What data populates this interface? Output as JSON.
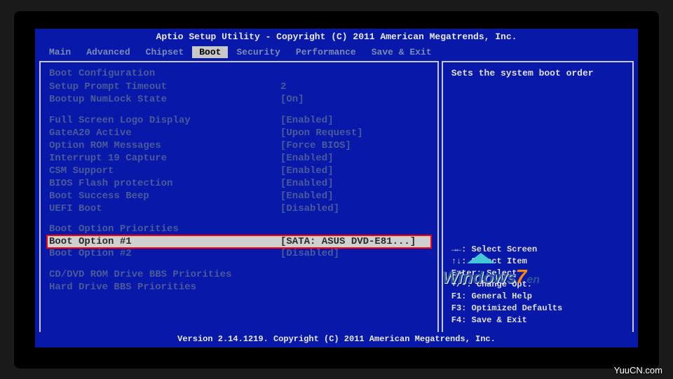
{
  "header": {
    "title": "Aptio Setup Utility - Copyright (C) 2011 American Megatrends, Inc."
  },
  "menu": {
    "items": [
      "Main",
      "Advanced",
      "Chipset",
      "Boot",
      "Security",
      "Performance",
      "Save & Exit"
    ],
    "active_index": 3
  },
  "boot": {
    "section_config": "Boot Configuration",
    "rows_config": [
      {
        "label": "Setup Prompt Timeout",
        "value": "2"
      },
      {
        "label": "Bootup NumLock State",
        "value": "[On]"
      }
    ],
    "rows_display": [
      {
        "label": "Full Screen Logo Display",
        "value": "[Enabled]"
      },
      {
        "label": "GateA20 Active",
        "value": "[Upon Request]"
      },
      {
        "label": "Option ROM Messages",
        "value": "[Force BIOS]"
      },
      {
        "label": "Interrupt 19 Capture",
        "value": "[Enabled]"
      },
      {
        "label": "CSM Support",
        "value": "[Enabled]"
      },
      {
        "label": "BIOS Flash protection",
        "value": "[Enabled]"
      },
      {
        "label": "Boot Success Beep",
        "value": "[Enabled]"
      },
      {
        "label": "UEFI Boot",
        "value": "[Disabled]"
      }
    ],
    "section_priorities": "Boot Option Priorities",
    "highlighted": {
      "label": "Boot Option #1",
      "value": "[SATA: ASUS DVD-E81...]"
    },
    "rows_priorities": [
      {
        "label": "Boot Option #2",
        "value": "[Disabled]"
      }
    ],
    "rows_bbs": [
      {
        "label": "CD/DVD ROM Drive BBS Priorities",
        "value": ""
      },
      {
        "label": "Hard Drive BBS Priorities",
        "value": ""
      }
    ]
  },
  "side": {
    "help": "Sets the system boot order",
    "keys": [
      "→←: Select Screen",
      "↑↓: Select Item",
      "Enter: Select",
      "+/-: Change Opt.",
      "F1: General Help",
      "F3: Optimized Defaults",
      "F4: Save & Exit"
    ]
  },
  "footer": {
    "text": "Version 2.14.1219. Copyright (C) 2011 American Megatrends, Inc."
  },
  "watermark": {
    "site": "YuuCN.com",
    "logo_text": "Windows",
    "logo_num": "7",
    "logo_suffix": "en"
  }
}
